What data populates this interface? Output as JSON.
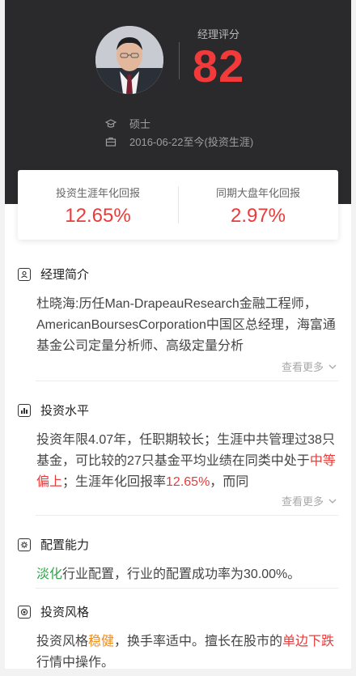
{
  "manager": {
    "score_label": "经理评分",
    "score": "82",
    "education": "硕士",
    "tenure": "2016-06-22至今(投资生涯)"
  },
  "returns": {
    "career_label": "投资生涯年化回报",
    "career_value": "12.65%",
    "market_label": "同期大盘年化回报",
    "market_value": "2.97%"
  },
  "intro": {
    "title": "经理简介",
    "text": "杜晓海:历任Man-DrapeauResearch金融工程师，AmericanBoursesCorporation中国区总经理，海富通基金公司定量分析师、高级定量分析",
    "more": "查看更多"
  },
  "invest_level": {
    "title": "投资水平",
    "text_a": "投资年限4.07年，任职期较长；生涯中共管理过38只基金，可比较的27只基金平均业绩在同类中处于",
    "highlight_a": "中等偏上",
    "text_b": "；生涯年化回报率",
    "highlight_b": "12.65%",
    "text_c": "，而同",
    "more": "查看更多"
  },
  "allocation": {
    "title": "配置能力",
    "highlight": "淡化",
    "text": "行业配置，行业的配置成功率为30.00%。"
  },
  "style": {
    "title": "投资风格",
    "text_a": "投资风格",
    "highlight_a": "稳健",
    "text_b": "，换手率适中。擅长在股市的",
    "highlight_b": "单边下跌",
    "text_c": "行情中操作。"
  },
  "colors": {
    "header_bg": "#2a2a2c",
    "accent_red": "#ea3b3b",
    "accent_green": "#2ea84a",
    "accent_orange": "#f08c1a"
  },
  "icons": {
    "education": "graduation-cap-icon",
    "tenure": "briefcase-icon",
    "intro": "person-card-icon",
    "invest_level": "bar-chart-icon",
    "allocation": "gear-icon",
    "style": "coin-icon",
    "more": "chevron-down-icon"
  }
}
